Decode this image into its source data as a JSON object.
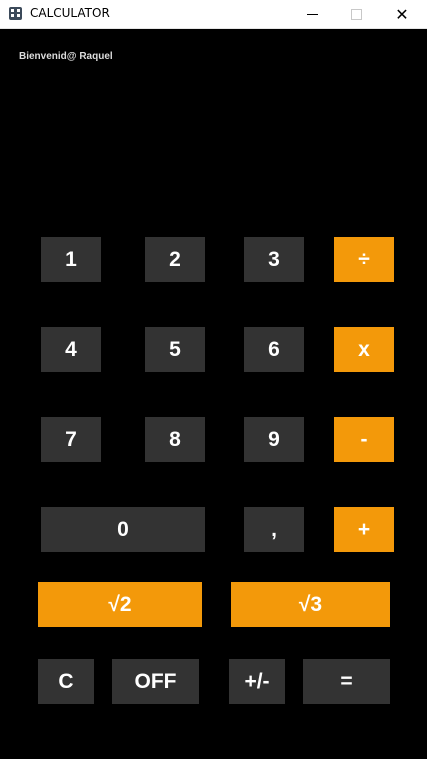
{
  "window": {
    "title": "CALCULATOR",
    "minimize_icon": "minimize-icon",
    "maximize_icon": "maximize-icon",
    "close_label": "✕"
  },
  "welcome": "Bienvenid@ Raquel",
  "colors": {
    "background": "#000000",
    "button_dark": "#333333",
    "button_accent": "#f3990a",
    "text": "#ffffff"
  },
  "keys": {
    "k1": "1",
    "k2": "2",
    "k3": "3",
    "div": "÷",
    "k4": "4",
    "k5": "5",
    "k6": "6",
    "mul": "x",
    "k7": "7",
    "k8": "8",
    "k9": "9",
    "sub": "-",
    "k0": "0",
    "comma": ",",
    "add": "+",
    "sqrt2": "√2",
    "sqrt3": "√3",
    "clear": "C",
    "off": "OFF",
    "negate": "+/-",
    "equals": "="
  }
}
